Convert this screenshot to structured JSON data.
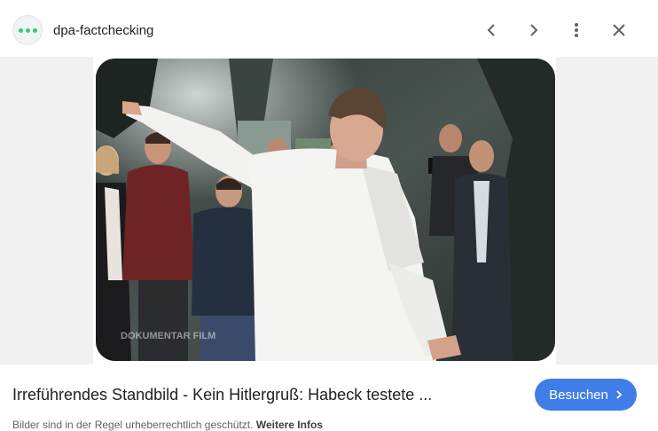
{
  "header": {
    "site_name": "dpa-factchecking",
    "icons": [
      "favicon-dots-icon",
      "chevron-left-icon",
      "chevron-right-icon",
      "more-vert-icon",
      "close-icon"
    ]
  },
  "image": {
    "watermark": "DOKUMENTAR FILM"
  },
  "result": {
    "title": "Irreführendes Standbild - Kein Hitlergruß: Habeck testete ...",
    "visit_label": "Besuchen",
    "copyright_text": "Bilder sind in der Regel urheberrechtlich geschützt.",
    "more_info_label": "Weitere Infos"
  },
  "colors": {
    "accent": "#3f7ee8",
    "favicon_dots": "#39c97a"
  }
}
